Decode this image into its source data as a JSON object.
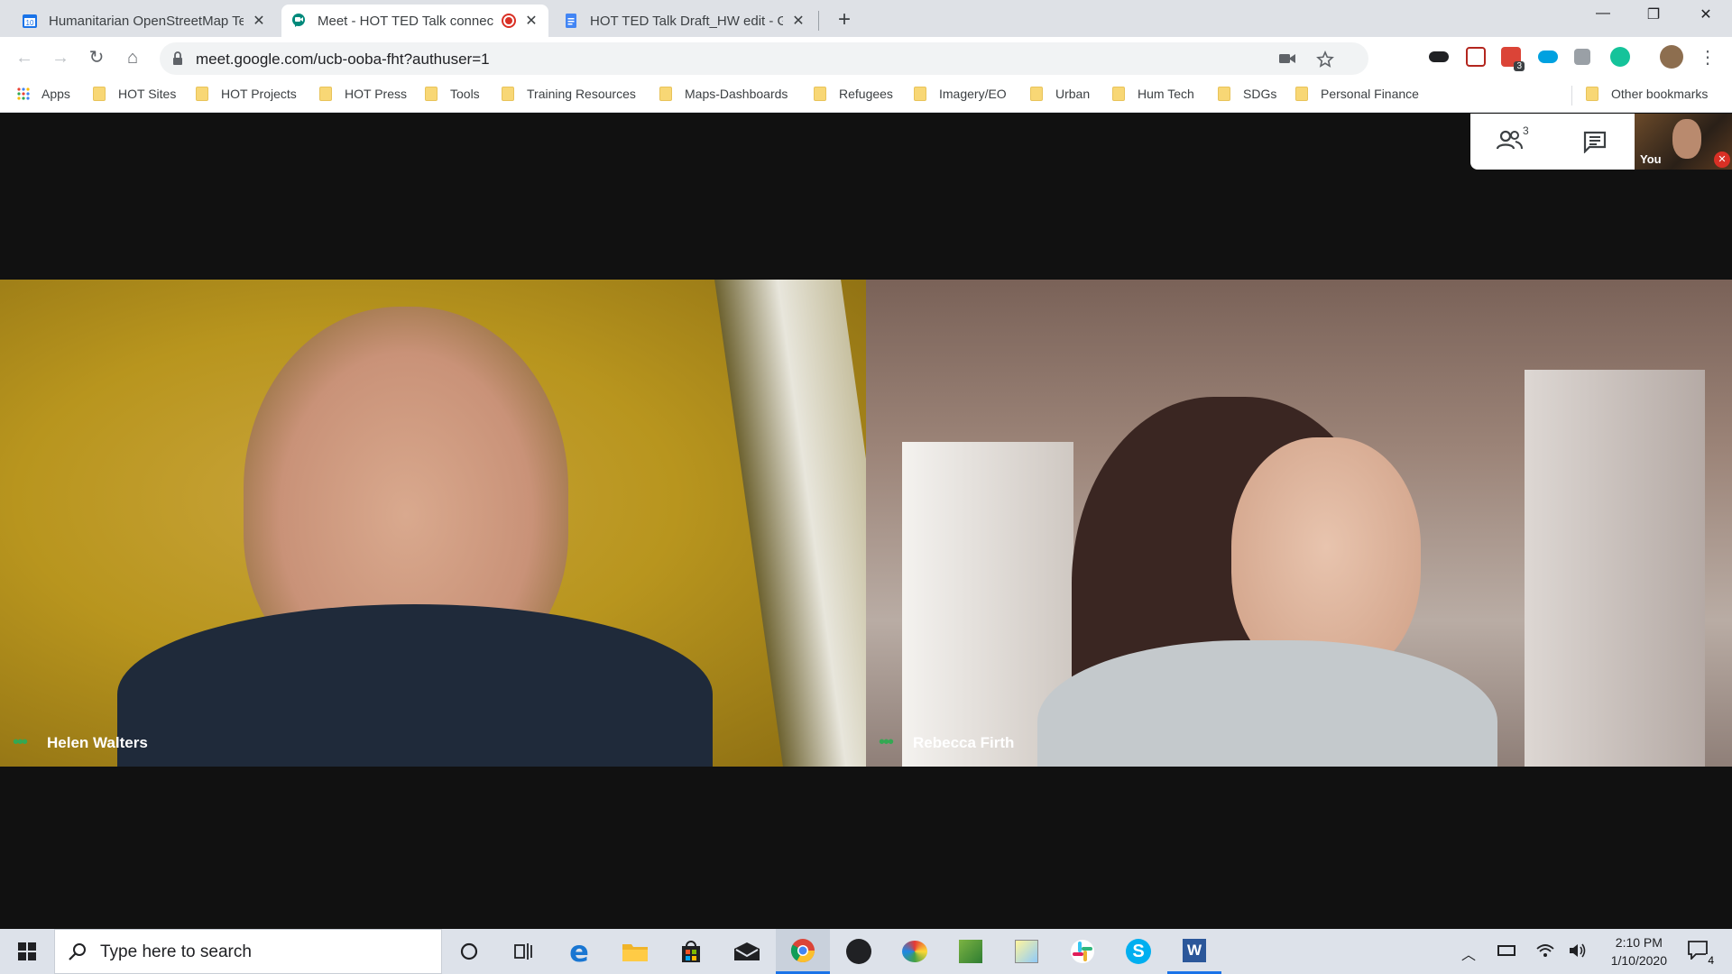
{
  "browser": {
    "tabs": [
      {
        "title": "Humanitarian OpenStreetMap Te",
        "favicon": "calendar-icon",
        "badge": "10",
        "active": false
      },
      {
        "title": "Meet - HOT TED Talk connec",
        "favicon": "meet-icon",
        "active": true
      },
      {
        "title": "HOT TED Talk Draft_HW edit - Go",
        "favicon": "docs-icon",
        "active": false
      }
    ],
    "new_tab_label": "+",
    "url": "meet.google.com/ucb-ooba-fht?authuser=1",
    "extension_badge": "3",
    "bookmarks": [
      {
        "label": "Apps",
        "icon": "apps-grid-icon"
      },
      {
        "label": "HOT Sites",
        "icon": "folder-icon"
      },
      {
        "label": "HOT Projects",
        "icon": "folder-icon"
      },
      {
        "label": "HOT Press",
        "icon": "folder-icon"
      },
      {
        "label": "Tools",
        "icon": "folder-icon"
      },
      {
        "label": "Training Resources",
        "icon": "folder-icon"
      },
      {
        "label": "Maps-Dashboards",
        "icon": "folder-icon"
      },
      {
        "label": "Refugees",
        "icon": "folder-icon"
      },
      {
        "label": "Imagery/EO",
        "icon": "folder-icon"
      },
      {
        "label": "Urban",
        "icon": "folder-icon"
      },
      {
        "label": "Hum Tech",
        "icon": "folder-icon"
      },
      {
        "label": "SDGs",
        "icon": "folder-icon"
      },
      {
        "label": "Personal Finance",
        "icon": "folder-icon"
      }
    ],
    "other_bookmarks": "Other bookmarks"
  },
  "meet": {
    "participant_count": "3",
    "self_label": "You",
    "participants": [
      {
        "name": "Helen Walters"
      },
      {
        "name": "Rebecca Firth"
      }
    ]
  },
  "taskbar": {
    "search_placeholder": "Type here to search",
    "time": "2:10 PM",
    "date": "1/10/2020",
    "notification_count": "4"
  },
  "colors": {
    "accent": "#1a73e8",
    "meet_green": "#34a853",
    "record_red": "#d93025"
  }
}
